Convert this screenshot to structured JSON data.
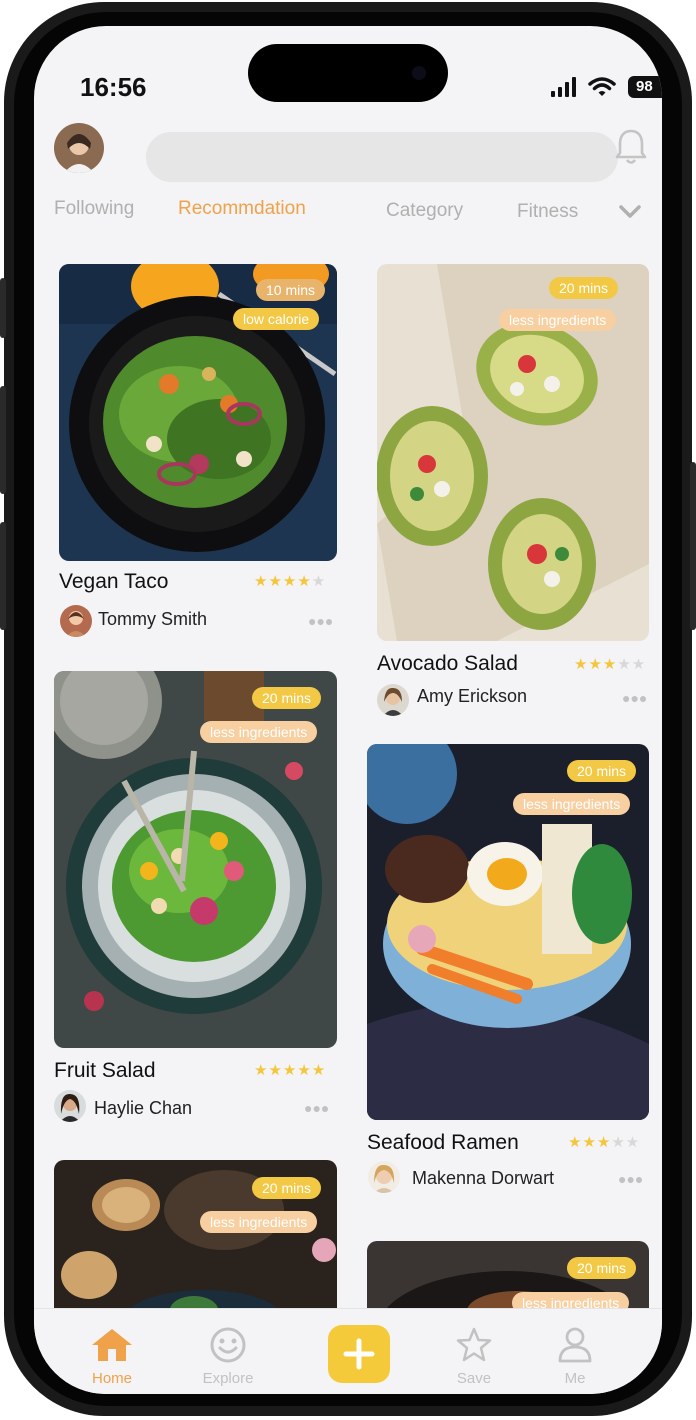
{
  "status_bar": {
    "time": "16:56",
    "battery": "98"
  },
  "tabs": [
    {
      "label": "Following",
      "active": false
    },
    {
      "label": "Recommdation",
      "active": true
    },
    {
      "label": "Category",
      "active": false
    },
    {
      "label": "Fitness",
      "active": false
    }
  ],
  "cards": [
    {
      "title": "Vegan Taco",
      "author": "Tommy Smith",
      "rating": 4,
      "tags": [
        "10 mins",
        "low calorie"
      ]
    },
    {
      "title": "Avocado Salad",
      "author": "Amy Erickson",
      "rating": 3,
      "tags": [
        "20 mins",
        "less ingredients"
      ]
    },
    {
      "title": "Fruit Salad",
      "author": "Haylie Chan",
      "rating": 5,
      "tags": [
        "20 mins",
        "less ingredients"
      ]
    },
    {
      "title": "Seafood Ramen",
      "author": "Makenna Dorwart",
      "rating": 3,
      "tags": [
        "20 mins",
        "less ingredients"
      ]
    },
    {
      "title": "",
      "author": "",
      "rating": 0,
      "tags": [
        "20 mins",
        "less ingredients"
      ]
    },
    {
      "title": "",
      "author": "",
      "rating": 0,
      "tags": [
        "20 mins",
        "less ingredients"
      ]
    }
  ],
  "nav": [
    {
      "label": "Home",
      "icon": "home-icon",
      "active": true
    },
    {
      "label": "Explore",
      "icon": "smiley-icon",
      "active": false
    },
    {
      "label": "",
      "icon": "plus-icon",
      "active": false
    },
    {
      "label": "Save",
      "icon": "star-icon",
      "active": false
    },
    {
      "label": "Me",
      "icon": "person-icon",
      "active": false
    }
  ],
  "colors": {
    "accent": "#f0a24a",
    "badge_yellow": "#f2c844",
    "star": "#f4c63d",
    "add_button": "#f5ca3a"
  }
}
